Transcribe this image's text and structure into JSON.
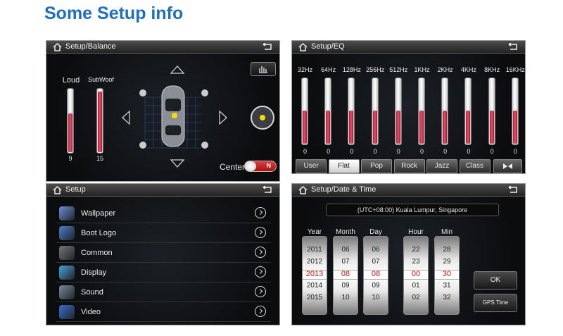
{
  "page_title": "Some Setup info",
  "balance": {
    "title": "Setup/Balance",
    "loud": {
      "label": "Loud",
      "value": "9",
      "level": 0.6
    },
    "subwoof": {
      "label": "SubWoof",
      "value": "15",
      "level": 0.95
    },
    "center_label": "Center",
    "center_toggle": "N"
  },
  "eq": {
    "title": "Setup/EQ",
    "bands": [
      {
        "freq": "32Hz",
        "value": "0"
      },
      {
        "freq": "64Hz",
        "value": "0"
      },
      {
        "freq": "128Hz",
        "value": "0"
      },
      {
        "freq": "256Hz",
        "value": "0"
      },
      {
        "freq": "512Hz",
        "value": "0"
      },
      {
        "freq": "1KHz",
        "value": "0"
      },
      {
        "freq": "2KHz",
        "value": "0"
      },
      {
        "freq": "4KHz",
        "value": "0"
      },
      {
        "freq": "8KHz",
        "value": "0"
      },
      {
        "freq": "16KHz",
        "value": "0"
      }
    ],
    "band_level": 0.5,
    "presets": [
      "User",
      "Flat",
      "Pop",
      "Rock",
      "Jazz",
      "Class"
    ],
    "active_preset": "Flat"
  },
  "setup": {
    "title": "Setup",
    "items": [
      {
        "label": "Wallpaper",
        "icon": "wallpaper-icon",
        "color": "#6b8fd8"
      },
      {
        "label": "Boot Logo",
        "icon": "boot-logo-icon",
        "color": "#4a7fd0"
      },
      {
        "label": "Common",
        "icon": "common-gear-icon",
        "color": "#777777"
      },
      {
        "label": "Display",
        "icon": "display-icon",
        "color": "#4aa0e0"
      },
      {
        "label": "Sound",
        "icon": "sound-icon",
        "color": "#7a8a9a"
      },
      {
        "label": "Video",
        "icon": "video-icon",
        "color": "#3a6fd0"
      }
    ]
  },
  "datetime": {
    "title": "Setup/Date & Time",
    "timezone": "(UTC+08:00) Kuala Lumpur, Singapore",
    "columns": [
      {
        "label": "Year",
        "values": [
          "2011",
          "2012",
          "2013",
          "2014",
          "2015"
        ],
        "selected": 2
      },
      {
        "label": "Month",
        "values": [
          "06",
          "07",
          "08",
          "09",
          "10"
        ],
        "selected": 2
      },
      {
        "label": "Day",
        "values": [
          "06",
          "07",
          "08",
          "09",
          "10"
        ],
        "selected": 2
      },
      {
        "label": "Hour",
        "values": [
          "22",
          "23",
          "00",
          "01",
          "02"
        ],
        "selected": 2
      },
      {
        "label": "Min",
        "values": [
          "28",
          "29",
          "30",
          "31",
          "32"
        ],
        "selected": 2
      }
    ],
    "ok_label": "OK",
    "gps_label": "GPS Time"
  },
  "colors": {
    "accent_red": "#d01010",
    "title_blue": "#1f6fc0"
  }
}
